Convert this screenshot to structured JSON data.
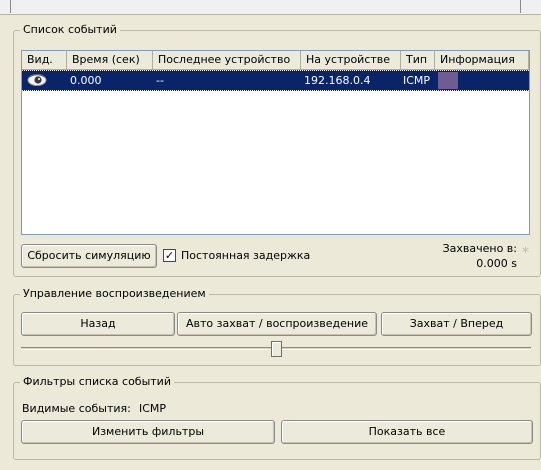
{
  "event_list": {
    "legend": "Список событий",
    "columns": [
      "Вид.",
      "Время (сек)",
      "Последнее устройство",
      "На устройстве",
      "Тип",
      "Информация"
    ],
    "rows": [
      {
        "icon": "eye-icon",
        "time": "0.000",
        "last_device": "--",
        "at_device": "192.168.0.4",
        "type": "ICMP",
        "info_color": "#6f5c94"
      }
    ],
    "reset_button": "Сбросить симуляцию",
    "constant_delay_label": "Постоянная задержка",
    "constant_delay_checked": true,
    "captured_label": "Захвачено в:",
    "captured_value": "0.000 s"
  },
  "playback": {
    "legend": "Управление воспроизведением",
    "back_button": "Назад",
    "auto_button": "Авто захват / воспроизведение",
    "forward_button": "Захват / Вперед",
    "slider_position": 0.5
  },
  "filters": {
    "legend": "Фильтры списка событий",
    "visible_events_label": "Видимые события:",
    "visible_events_value": "ICMP",
    "edit_button": "Изменить фильтры",
    "show_all_button": "Показать все"
  },
  "colors": {
    "selection": "#0a246a",
    "panel": "#ece9d8"
  }
}
